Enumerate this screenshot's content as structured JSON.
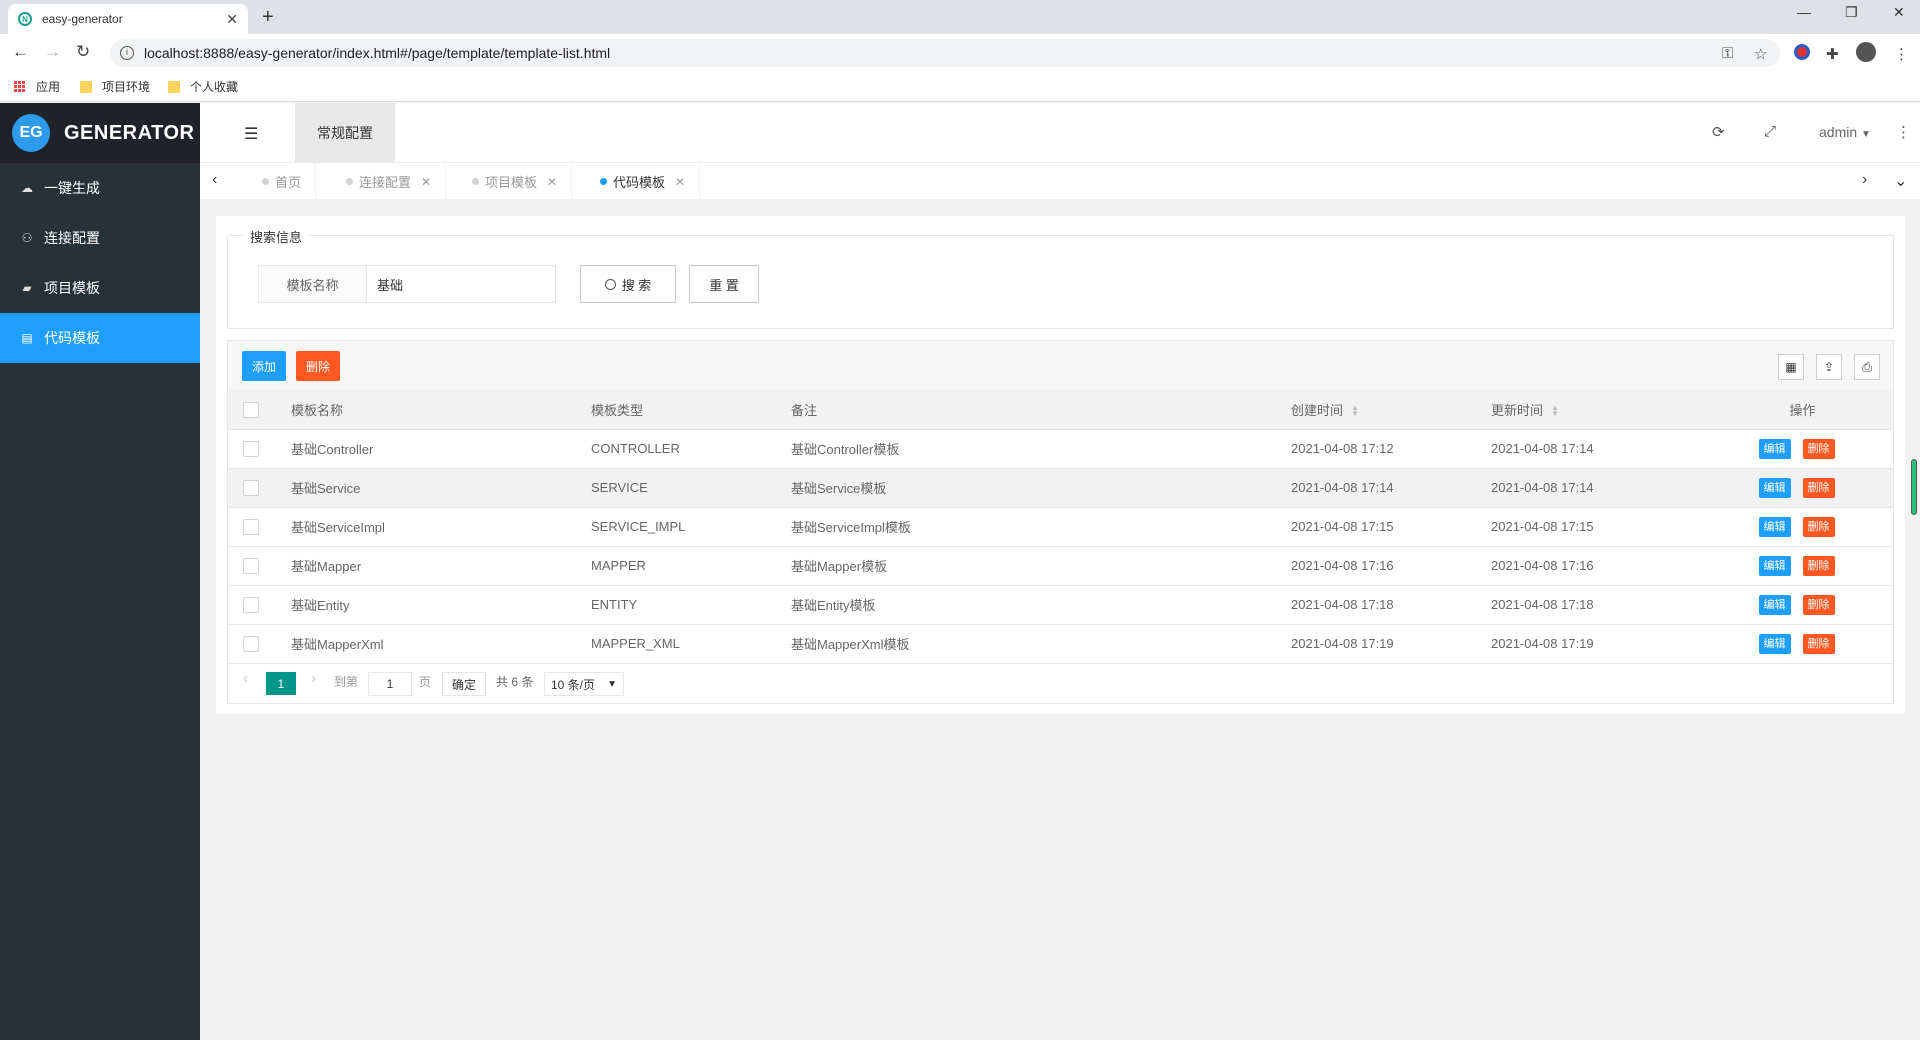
{
  "browser": {
    "tab_title": "easy-generator",
    "url": "localhost:8888/easy-generator/index.html#/page/template/template-list.html",
    "bookmarks": [
      "应用",
      "项目环境",
      "个人收藏"
    ]
  },
  "sidebar": {
    "logo_badge": "EG",
    "logo_text": "GENERATOR",
    "items": [
      {
        "label": "一键生成",
        "icon": "cloud-icon"
      },
      {
        "label": "连接配置",
        "icon": "sitemap-icon"
      },
      {
        "label": "项目模板",
        "icon": "folder-icon"
      },
      {
        "label": "代码模板",
        "icon": "file-code-icon",
        "active": true
      }
    ]
  },
  "header": {
    "tab": "常规配置",
    "user": "admin"
  },
  "page_tabs": [
    "首页",
    "连接配置",
    "项目模板",
    "代码模板"
  ],
  "search": {
    "legend": "搜索信息",
    "label": "模板名称",
    "value": "基础",
    "search_btn": "搜 索",
    "reset_btn": "重 置"
  },
  "toolbar": {
    "add": "添加",
    "delete": "删除"
  },
  "table": {
    "columns": [
      "模板名称",
      "模板类型",
      "备注",
      "创建时间",
      "更新时间",
      "操作"
    ],
    "rows": [
      {
        "name": "基础Controller",
        "type": "CONTROLLER",
        "remark": "基础Controller模板",
        "created": "2021-04-08 17:12",
        "updated": "2021-04-08 17:14"
      },
      {
        "name": "基础Service",
        "type": "SERVICE",
        "remark": "基础Service模板",
        "created": "2021-04-08 17:14",
        "updated": "2021-04-08 17:14"
      },
      {
        "name": "基础ServiceImpl",
        "type": "SERVICE_IMPL",
        "remark": "基础ServiceImpl模板",
        "created": "2021-04-08 17:15",
        "updated": "2021-04-08 17:15"
      },
      {
        "name": "基础Mapper",
        "type": "MAPPER",
        "remark": "基础Mapper模板",
        "created": "2021-04-08 17:16",
        "updated": "2021-04-08 17:16"
      },
      {
        "name": "基础Entity",
        "type": "ENTITY",
        "remark": "基础Entity模板",
        "created": "2021-04-08 17:18",
        "updated": "2021-04-08 17:18"
      },
      {
        "name": "基础MapperXml",
        "type": "MAPPER_XML",
        "remark": "基础MapperXml模板",
        "created": "2021-04-08 17:19",
        "updated": "2021-04-08 17:19"
      }
    ],
    "op_edit": "编辑",
    "op_delete": "删除"
  },
  "pager": {
    "current": "1",
    "goto_label": "到第",
    "goto_value": "1",
    "page_unit": "页",
    "confirm": "确定",
    "total": "共 6 条",
    "page_size": "10 条/页"
  },
  "colors": {
    "sidebar_bg": "#263238",
    "accent": "#1e9fff",
    "danger": "#ff5722",
    "pager": "#009688"
  }
}
